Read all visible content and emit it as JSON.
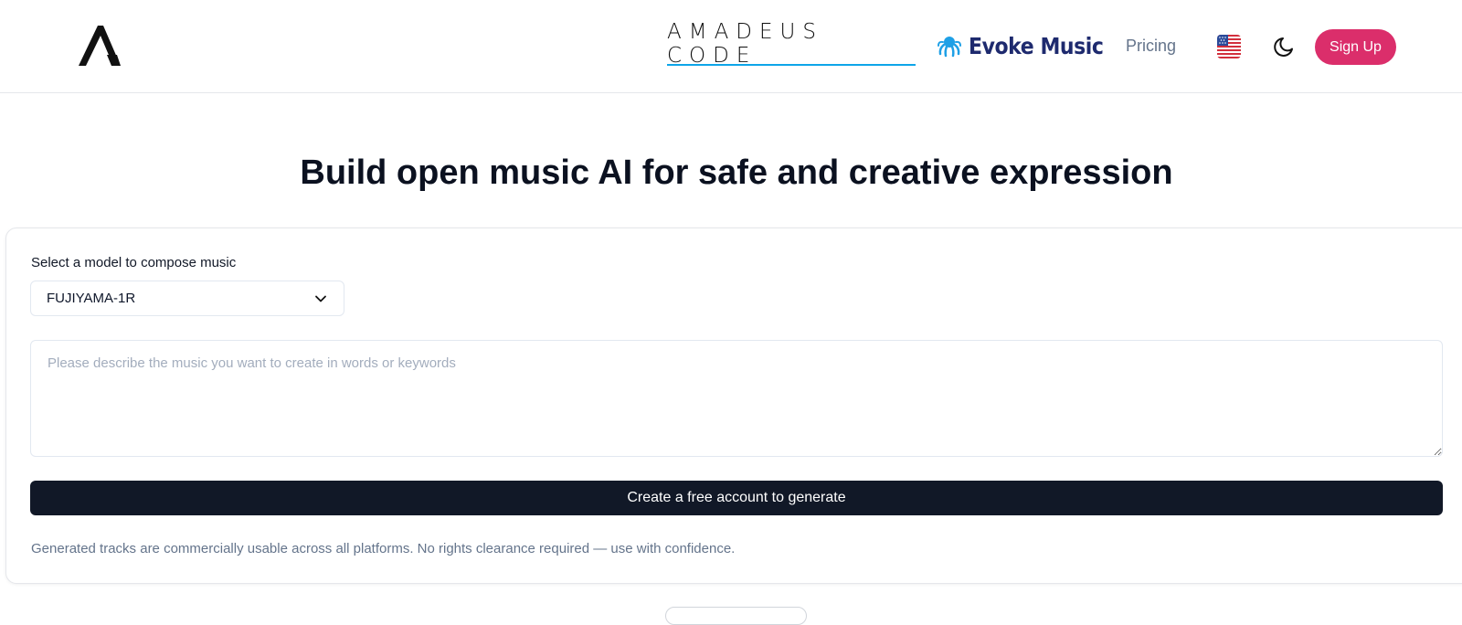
{
  "header": {
    "logo_alt": "Amadeus Code logo",
    "nav": {
      "amadeus_label": "AMADEUS CODE",
      "evoke_label": "Evoke Music",
      "pricing_label": "Pricing",
      "language_icon": "us-flag-icon",
      "theme_icon": "moon-icon",
      "signup_label": "Sign Up"
    }
  },
  "main": {
    "title": "Build open music AI for safe and creative expression",
    "form": {
      "model_label": "Select a model to compose music",
      "model_selected": "FUJIYAMA-1R",
      "prompt_placeholder": "Please describe the music you want to create in words or keywords",
      "prompt_value": "",
      "generate_label": "Create a free account to generate",
      "disclaimer": "Generated tracks are commercially usable across all platforms. No rights clearance required — use with confidence."
    }
  },
  "colors": {
    "accent_pink": "#db2e6b",
    "active_underline": "#0ea5e9",
    "evoke_navy": "#1e2a6e",
    "evoke_icon": "#1ea0e6",
    "button_dark": "#111827"
  }
}
